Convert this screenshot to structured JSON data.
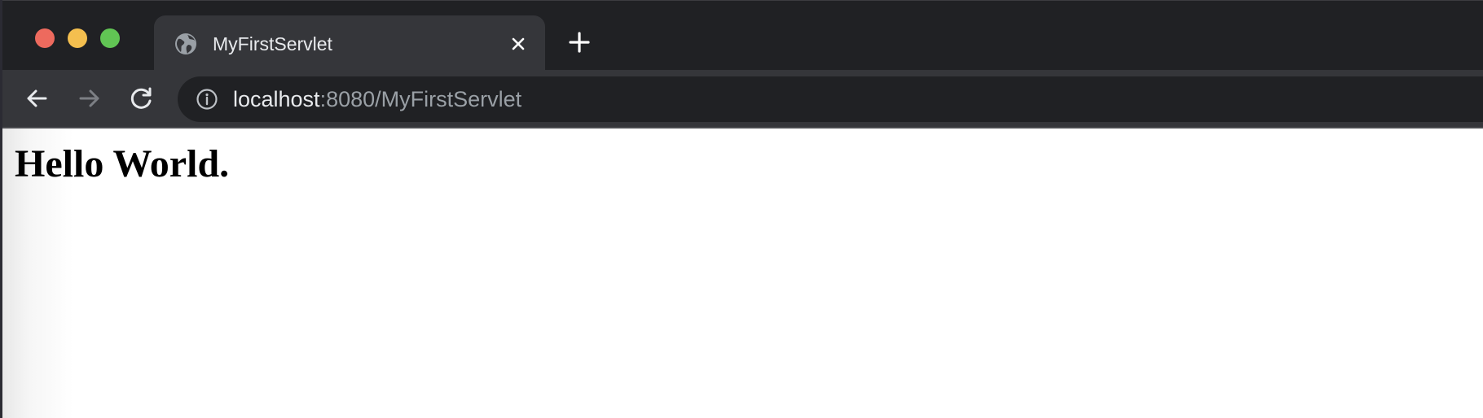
{
  "browser": {
    "tab": {
      "title": "MyFirstServlet",
      "icon": "globe-icon"
    },
    "toolbar": {
      "back_icon": "arrow-left-icon",
      "forward_icon": "arrow-right-icon",
      "reload_icon": "reload-icon"
    },
    "address_bar": {
      "host": "localhost",
      "path": ":8080/MyFirstServlet",
      "info_icon": "info-icon"
    }
  },
  "page": {
    "heading": "Hello World."
  },
  "colors": {
    "titlebar": "#202124",
    "tab_active": "#35363a",
    "omnibox": "#202124",
    "text_primary": "#e8eaed",
    "text_secondary": "#9aa0a6",
    "close_red": "#ed6a5e",
    "minimize_yellow": "#f4bf4f",
    "zoom_green": "#61c554"
  }
}
